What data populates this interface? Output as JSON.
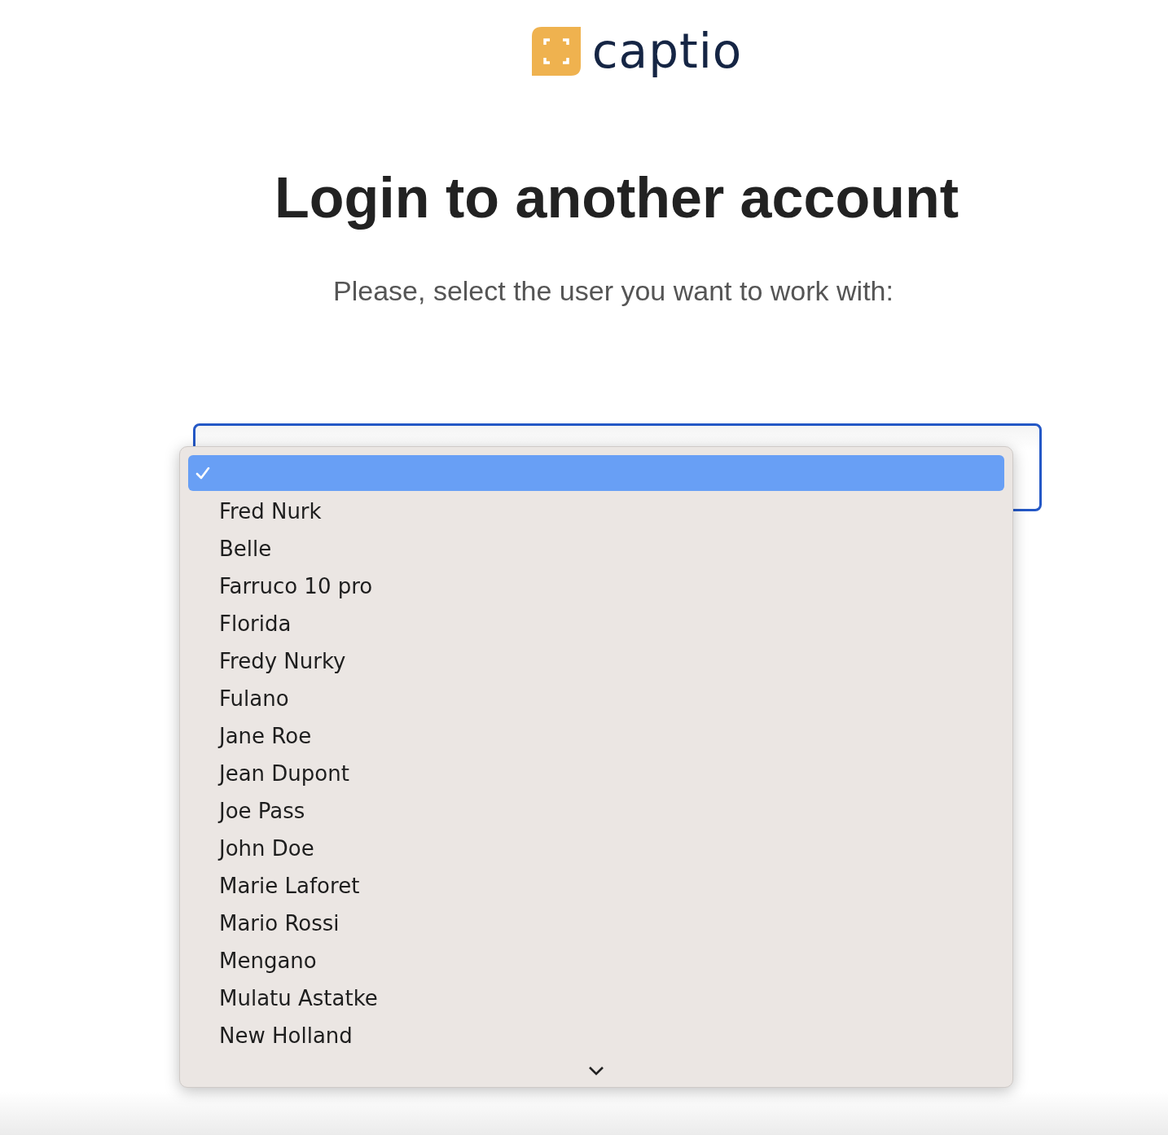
{
  "logo": {
    "wordmark": "captio"
  },
  "heading": "Login to another account",
  "subtitle": "Please, select the user you want to work with:",
  "user_select": {
    "open": true,
    "options": [
      {
        "selected": true
      },
      {
        "label": "Fred Nurk",
        "selected": false
      },
      {
        "label": "Belle",
        "selected": false
      },
      {
        "label": "Farruco 10 pro",
        "selected": false
      },
      {
        "label": "Florida",
        "selected": false
      },
      {
        "label": "Fredy Nurky",
        "selected": false
      },
      {
        "label": "Fulano",
        "selected": false
      },
      {
        "label": "Jane Roe",
        "selected": false
      },
      {
        "label": "Jean Dupont",
        "selected": false
      },
      {
        "label": "Joe Pass",
        "selected": false
      },
      {
        "label": "John Doe",
        "selected": false
      },
      {
        "label": "Marie Laforet",
        "selected": false
      },
      {
        "label": "Mario Rossi",
        "selected": false
      },
      {
        "label": "Mengano",
        "selected": false
      },
      {
        "label": "Mulatu Astatke",
        "selected": false
      },
      {
        "label": "New Holland",
        "selected": false
      }
    ]
  }
}
